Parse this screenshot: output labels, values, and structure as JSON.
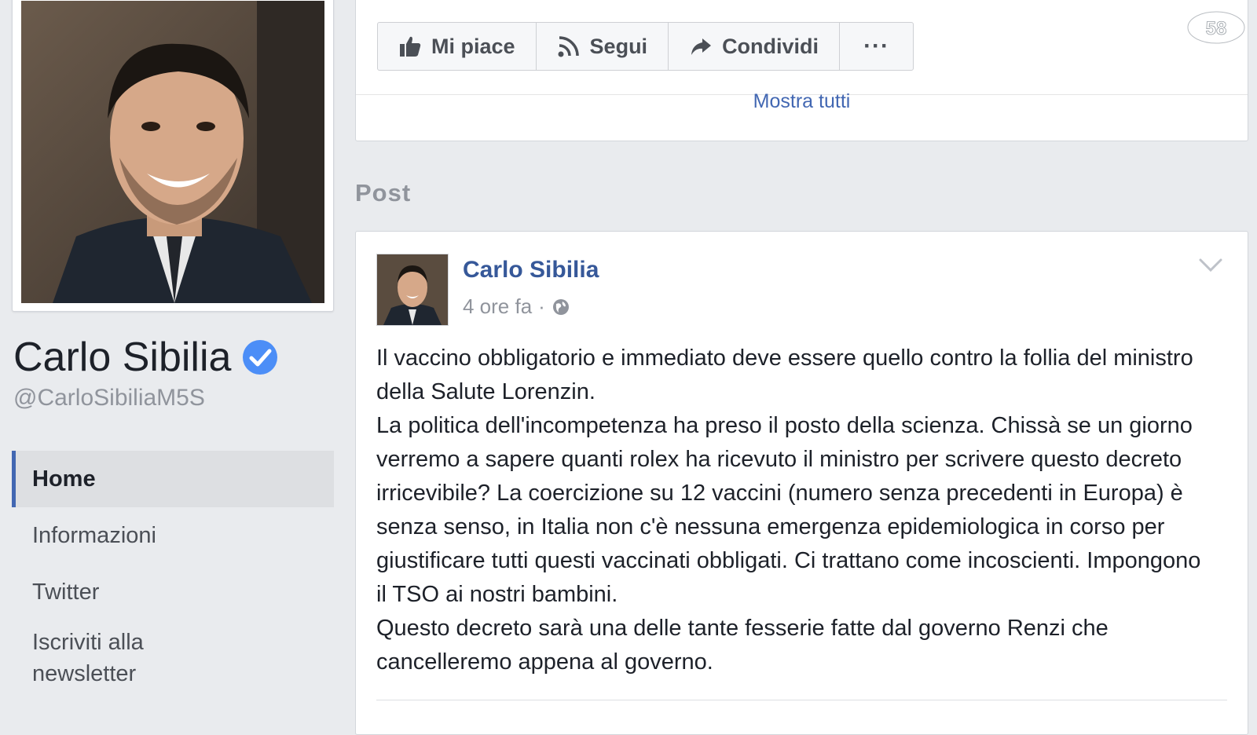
{
  "profile": {
    "name": "Carlo Sibilia",
    "handle": "@CarloSibiliaM5S",
    "verified_icon": "verified-badge-icon"
  },
  "nav": {
    "items": [
      {
        "label": "Home",
        "active": true
      },
      {
        "label": "Informazioni"
      },
      {
        "label": "Twitter"
      },
      {
        "label": "Iscriviti alla newsletter"
      }
    ]
  },
  "actions": {
    "like_label": "Mi piace",
    "follow_label": "Segui",
    "share_label": "Condividi",
    "more_label": "···"
  },
  "top_card": {
    "show_all": "Mostra tutti"
  },
  "posts_section": {
    "title": "Post"
  },
  "post": {
    "author": "Carlo Sibilia",
    "time": "4 ore fa",
    "separator": "·",
    "text": "Il vaccino obbligatorio e immediato deve essere quello contro la follia del ministro della Salute Lorenzin.\nLa politica dell'incompetenza ha preso il posto della scienza. Chissà se un giorno verremo a sapere quanti rolex ha ricevuto il ministro per scrivere questo decreto irricevibile? La coercizione su 12 vaccini (numero senza precedenti in Europa) è senza senso, in Italia non c'è nessuna emergenza epidemiologica in corso per giustificare tutti questi vaccinati obbligati. Ci trattano come incoscienti. Impongono il TSO ai nostri bambini.\nQuesto decreto sarà una delle tante fesserie fatte dal governo Renzi che cancelleremo appena al governo."
  },
  "watermark": {
    "text": "58"
  },
  "colors": {
    "brand_blue": "#4267b2",
    "link_blue": "#365899",
    "page_bg": "#e9ebee",
    "verified": "#4c8ef7"
  }
}
